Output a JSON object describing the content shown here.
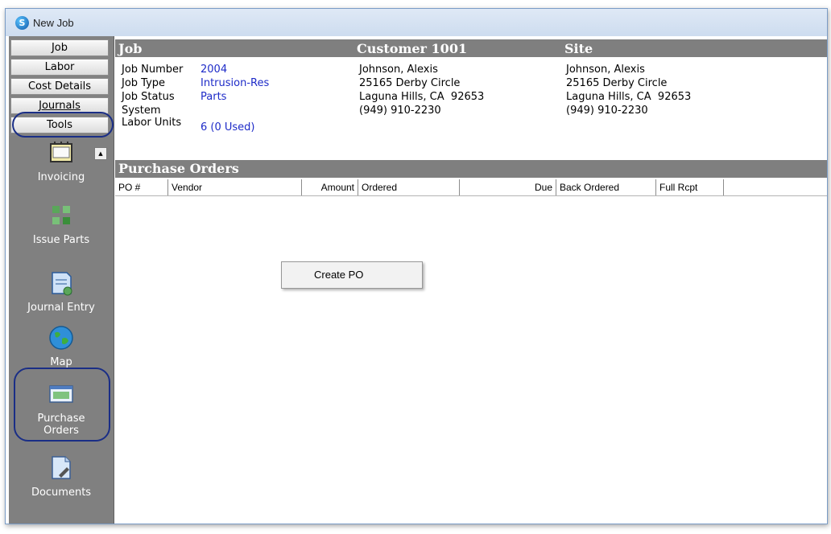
{
  "window": {
    "title": "New Job",
    "app_icon_letter": "S"
  },
  "sidebar": {
    "tabs": [
      {
        "label": "Job"
      },
      {
        "label": "Labor"
      },
      {
        "label": "Cost Details"
      },
      {
        "label": "Journals"
      },
      {
        "label": "Tools"
      }
    ],
    "tools": [
      {
        "label": "Invoicing",
        "icon": "invoicing-icon"
      },
      {
        "label": "Issue Parts",
        "icon": "issue-parts-icon"
      },
      {
        "label": "Journal Entry",
        "icon": "journal-entry-icon"
      },
      {
        "label": "Map",
        "icon": "globe-icon"
      },
      {
        "label": "Purchase Orders",
        "icon": "purchase-orders-icon"
      },
      {
        "label": "Documents",
        "icon": "documents-icon"
      }
    ]
  },
  "job_section": {
    "job_title": "Job",
    "customer_title": "Customer 1001",
    "site_title": "Site",
    "fields": [
      {
        "label": "Job Number",
        "value": "2004"
      },
      {
        "label": "Job Type",
        "value": "Intrusion-Res"
      },
      {
        "label": "Job Status",
        "value": "Parts"
      },
      {
        "label": "System",
        "value": ""
      },
      {
        "label": "Labor Units",
        "value": "6 (0 Used)"
      }
    ],
    "customer": {
      "name": "Johnson, Alexis",
      "address1": "25165 Derby Circle",
      "address2": "Laguna Hills, CA  92653",
      "phone": "(949) 910-2230"
    },
    "site": {
      "name": "Johnson, Alexis",
      "address1": "25165 Derby Circle",
      "address2": "Laguna Hills, CA  92653",
      "phone": "(949) 910-2230"
    }
  },
  "purchase_orders": {
    "title": "Purchase Orders",
    "columns": [
      "PO #",
      "Vendor",
      "Amount",
      "Ordered",
      "Due",
      "Back Ordered",
      "Full Rcpt"
    ],
    "rows": []
  },
  "context_menu": {
    "items": [
      "Create PO"
    ]
  },
  "colors": {
    "header_bg": "#7f7f7f",
    "value_text": "#1e2bc8",
    "highlight_ring": "#1a2e86",
    "sidebar_bg": "#828282"
  }
}
